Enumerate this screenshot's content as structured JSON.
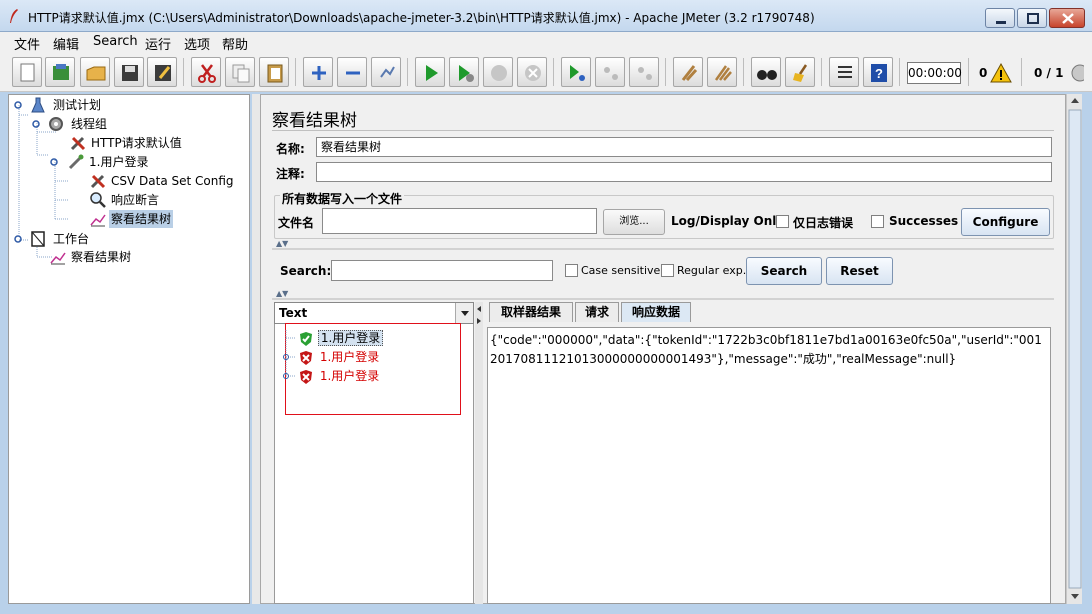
{
  "window": {
    "title": "HTTP请求默认值.jmx (C:\\Users\\Administrator\\Downloads\\apache-jmeter-3.2\\bin\\HTTP请求默认值.jmx) - Apache JMeter (3.2 r1790748)"
  },
  "menu": [
    "文件",
    "编辑",
    "Search",
    "运行",
    "选项",
    "帮助"
  ],
  "toolbar": {
    "buttons": [
      "new-icon",
      "templates-icon",
      "open-icon",
      "save-icon",
      "save-as-icon",
      "cut-icon",
      "copy-icon",
      "paste-icon",
      "expand-icon",
      "collapse-icon",
      "toggle-icon",
      "start-icon",
      "start-no-pause-icon",
      "stop-icon",
      "shutdown-icon",
      "remote-start-icon",
      "remote-stop-icon",
      "remote-shutdown-icon",
      "clear-icon",
      "clear-all-icon",
      "search-icon",
      "reset-search-icon",
      "function-helper-icon",
      "help-icon"
    ],
    "timer": "00:00:00",
    "error_count": "0",
    "thread_count": "0 / 1"
  },
  "tree": [
    {
      "label": "测试计划",
      "icon": "test-plan-icon"
    },
    {
      "label": "线程组",
      "icon": "thread-group-icon"
    },
    {
      "label": "HTTP请求默认值",
      "icon": "config-tools-icon"
    },
    {
      "label": "1.用户登录",
      "icon": "sampler-pipette-icon"
    },
    {
      "label": "CSV Data Set Config",
      "icon": "config-tools-icon"
    },
    {
      "label": "响应断言",
      "icon": "magnifier-icon"
    },
    {
      "label": "察看结果树",
      "icon": "listener-graph-icon"
    },
    {
      "label": "工作台",
      "icon": "workbench-icon"
    },
    {
      "label": "察看结果树",
      "icon": "listener-graph-icon"
    }
  ],
  "panel": {
    "title": "察看结果树",
    "name_label": "名称:",
    "name_value": "察看结果树",
    "comment_label": "注释:",
    "comment_value": "",
    "file_group_title": "所有数据写入一个文件",
    "filename_label": "文件名",
    "filename_value": "",
    "browse_label": "浏览...",
    "log_display_label": "Log/Display Only:",
    "errors_label": "仅日志错误",
    "successes_label": "Successes",
    "configure_label": "Configure"
  },
  "search": {
    "label": "Search:",
    "value": "",
    "case_sensitive_label": "Case sensitive",
    "regex_label": "Regular exp.",
    "search_button": "Search",
    "reset_button": "Reset"
  },
  "results": {
    "renderer": "Text",
    "items": [
      {
        "label": "1.用户登录",
        "status": "success"
      },
      {
        "label": "1.用户登录",
        "status": "failure"
      },
      {
        "label": "1.用户登录",
        "status": "failure"
      }
    ],
    "tabs": [
      "取样器结果",
      "请求",
      "响应数据"
    ],
    "response_text": "{\"code\":\"000000\",\"data\":{\"tokenId\":\"1722b3c0bf1811e7bd1a00163e0fc50a\",\"userId\":\"00120170811121013000000000001493\"},\"message\":\"成功\",\"realMessage\":null}"
  },
  "colors": {
    "selection": "#b9cfe6",
    "failure_text": "#d40000",
    "highlight_box": "#e0101a"
  }
}
